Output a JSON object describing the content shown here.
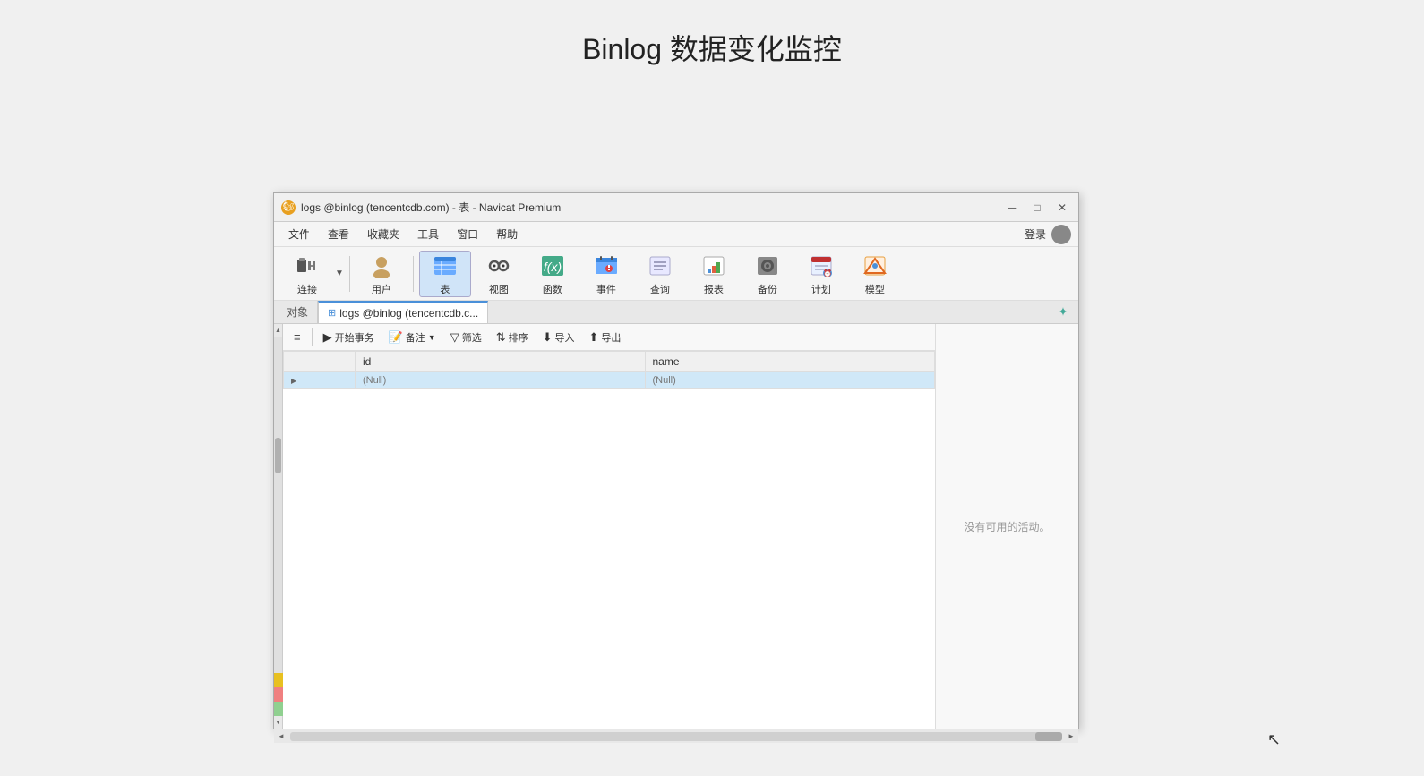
{
  "page": {
    "title": "Binlog 数据变化监控"
  },
  "window": {
    "title": "logs @binlog (tencentcdb.com) - 表 - Navicat Premium",
    "icon_text": "N"
  },
  "menu": {
    "items": [
      "文件",
      "查看",
      "收藏夹",
      "工具",
      "窗口",
      "帮助"
    ],
    "login_label": "登录"
  },
  "toolbar": {
    "items": [
      {
        "id": "connect",
        "icon": "🔌",
        "label": "连接"
      },
      {
        "id": "user",
        "icon": "👤",
        "label": "用户"
      },
      {
        "id": "table",
        "icon": "⊞",
        "label": "表",
        "active": true
      },
      {
        "id": "view",
        "icon": "👓",
        "label": "视图"
      },
      {
        "id": "func",
        "icon": "ƒ",
        "label": "函数"
      },
      {
        "id": "event",
        "icon": "🗄",
        "label": "事件"
      },
      {
        "id": "query",
        "icon": "📋",
        "label": "查询"
      },
      {
        "id": "report",
        "icon": "📊",
        "label": "报表"
      },
      {
        "id": "backup",
        "icon": "⚙",
        "label": "备份"
      },
      {
        "id": "plan",
        "icon": "📅",
        "label": "计划"
      },
      {
        "id": "model",
        "icon": "🔷",
        "label": "模型"
      }
    ]
  },
  "tabs": {
    "nav_tab": "对象",
    "active_tab": "logs @binlog (tencentcdb.c..."
  },
  "table_toolbar": {
    "buttons": [
      "≡",
      "开始事务",
      "备注",
      "筛选",
      "排序",
      "导入",
      "导出"
    ]
  },
  "table": {
    "columns": [
      "id",
      "name"
    ],
    "rows": [
      {
        "id": "(Null)",
        "name": "(Null)"
      }
    ]
  },
  "sidebar": {
    "tabs": [
      {
        "color": "#e8c020"
      },
      {
        "color": "#f08080"
      },
      {
        "color": "#90d090"
      }
    ]
  },
  "right_panel": {
    "no_activity": "没有可用的活动。"
  },
  "colors": {
    "accent_blue": "#4a90d9",
    "tab_active": "#d0e4f8"
  }
}
